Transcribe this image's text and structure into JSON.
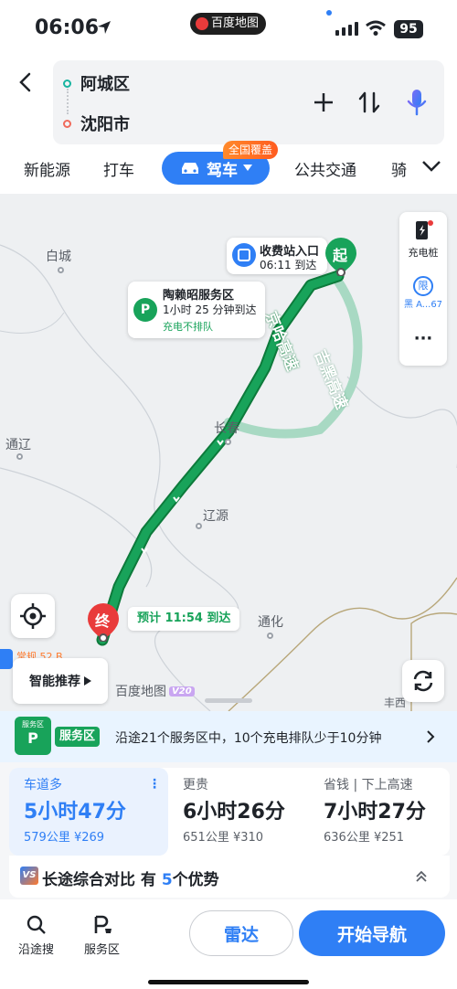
{
  "status_bar": {
    "time": "06:06",
    "app_pill": "百度地图",
    "battery": "95"
  },
  "route": {
    "origin": "阿城区",
    "destination": "沈阳市"
  },
  "tabs": {
    "items": [
      "新能源",
      "打车",
      "驾车",
      "公共交通",
      "骑"
    ],
    "active": "驾车",
    "active_badge": "全国覆盖"
  },
  "map": {
    "cities": [
      "白城",
      "通辽",
      "长春",
      "辽源",
      "通化",
      "丰西"
    ],
    "highway_main": "京哈高速",
    "highway_alt": "吉黑高速",
    "toll_callout": {
      "title": "收费站入口",
      "time": "06:11 到达"
    },
    "service_callout": {
      "title": "陶赖昭服务区",
      "time": "1小时 25 分钟到达",
      "note": "充电不排队"
    },
    "start_marker": "起",
    "end_marker": "终",
    "eta": "预计 11:54 到达",
    "right_panel": {
      "charging": "充电桩",
      "limit": "黑 A...67",
      "more": "···"
    },
    "smart_button": "智能推荐",
    "logo": "百度地图",
    "logo_version": "V20",
    "partial_label": "常规 52 B"
  },
  "service_bar": {
    "icon_label": "服务区",
    "chip": "服务区",
    "text": "沿途21个服务区中，10个充电排队少于10分钟"
  },
  "options": [
    {
      "tag": "车道多",
      "duration": "5小时47分",
      "meta": "579公里 ¥269",
      "selected": true
    },
    {
      "tag": "更贵",
      "duration": "6小时26分",
      "meta": "651公里 ¥310",
      "selected": false
    },
    {
      "tag": "省钱 | 下上高速",
      "duration": "7小时27分",
      "meta": "636公里 ¥251",
      "selected": false
    }
  ],
  "compare": {
    "vs": "VS",
    "prefix": "长途综合对比 有 ",
    "count": "5",
    "suffix": "个优势"
  },
  "bottom_nav": {
    "search": "沿途搜",
    "service": "服务区",
    "radar": "雷达",
    "start": "开始导航"
  },
  "colors": {
    "accent": "#2f7ff5",
    "route_main": "#18a35a",
    "route_alt": "#a8d9c3",
    "end": "#e93b3b"
  }
}
